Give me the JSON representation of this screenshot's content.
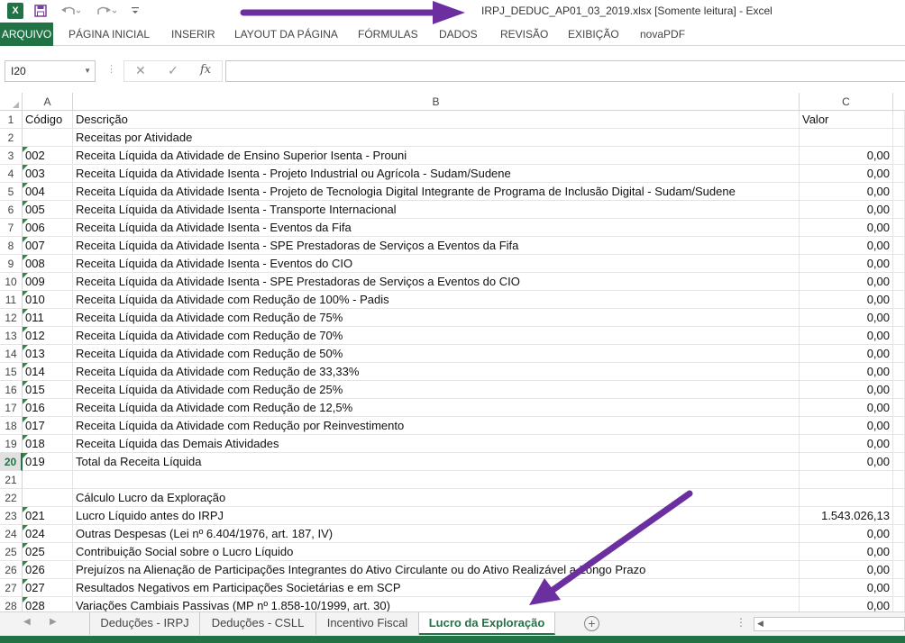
{
  "app": {
    "title": "IRPJ_DEDUC_AP01_03_2019.xlsx  [Somente leitura] - Excel",
    "logo_letter": "X",
    "icons": {
      "save": "save-icon",
      "undo": "undo-icon",
      "redo": "redo-icon",
      "customize": "customize-quick-access-icon"
    }
  },
  "ribbon": {
    "tabs": [
      {
        "label": "ARQUIVO",
        "active": true
      },
      {
        "label": "PÁGINA INICIAL"
      },
      {
        "label": "INSERIR"
      },
      {
        "label": "LAYOUT DA PÁGINA"
      },
      {
        "label": "FÓRMULAS"
      },
      {
        "label": "DADOS"
      },
      {
        "label": "REVISÃO"
      },
      {
        "label": "EXIBIÇÃO"
      },
      {
        "label": "novaPDF"
      }
    ]
  },
  "formula_bar": {
    "name_box": "I20",
    "formula": "",
    "fx_label": "fx"
  },
  "grid": {
    "columns": [
      "A",
      "B",
      "C"
    ],
    "selected_row": "20",
    "rows": [
      {
        "n": "1",
        "a": "Código",
        "b": "Descrição",
        "c": "Valor",
        "c_left": true
      },
      {
        "n": "2",
        "a": "",
        "b": "Receitas por Atividade",
        "c": ""
      },
      {
        "n": "3",
        "a": "002",
        "b": "Receita Líquida da Atividade de Ensino Superior Isenta - Prouni",
        "c": "0,00",
        "tri": true
      },
      {
        "n": "4",
        "a": "003",
        "b": "Receita Líquida da Atividade Isenta - Projeto Industrial ou Agrícola - Sudam/Sudene",
        "c": "0,00",
        "tri": true
      },
      {
        "n": "5",
        "a": "004",
        "b": "Receita Líquida da Atividade Isenta - Projeto de Tecnologia Digital Integrante de Programa de Inclusão Digital - Sudam/Sudene",
        "c": "0,00",
        "tri": true
      },
      {
        "n": "6",
        "a": "005",
        "b": "Receita Líquida da Atividade Isenta - Transporte Internacional",
        "c": "0,00",
        "tri": true
      },
      {
        "n": "7",
        "a": "006",
        "b": "Receita Líquida da Atividade Isenta - Eventos da Fifa",
        "c": "0,00",
        "tri": true
      },
      {
        "n": "8",
        "a": "007",
        "b": "Receita Líquida da Atividade Isenta - SPE Prestadoras de Serviços a Eventos da Fifa",
        "c": "0,00",
        "tri": true
      },
      {
        "n": "9",
        "a": "008",
        "b": "Receita Líquida da Atividade Isenta - Eventos do CIO",
        "c": "0,00",
        "tri": true
      },
      {
        "n": "10",
        "a": "009",
        "b": "Receita Líquida da Atividade Isenta - SPE Prestadoras de Serviços a Eventos do CIO",
        "c": "0,00",
        "tri": true
      },
      {
        "n": "11",
        "a": "010",
        "b": "Receita Líquida da Atividade com Redução de 100% - Padis",
        "c": "0,00",
        "tri": true
      },
      {
        "n": "12",
        "a": "011",
        "b": "Receita Líquida da Atividade com Redução de 75%",
        "c": "0,00",
        "tri": true
      },
      {
        "n": "13",
        "a": "012",
        "b": "Receita Líquida da Atividade com Redução de 70%",
        "c": "0,00",
        "tri": true
      },
      {
        "n": "14",
        "a": "013",
        "b": "Receita Líquida da Atividade com Redução de 50%",
        "c": "0,00",
        "tri": true
      },
      {
        "n": "15",
        "a": "014",
        "b": "Receita Líquida da Atividade com Redução de 33,33%",
        "c": "0,00",
        "tri": true
      },
      {
        "n": "16",
        "a": "015",
        "b": "Receita Líquida da Atividade com Redução de 25%",
        "c": "0,00",
        "tri": true
      },
      {
        "n": "17",
        "a": "016",
        "b": "Receita Líquida da Atividade com Redução de 12,5%",
        "c": "0,00",
        "tri": true
      },
      {
        "n": "18",
        "a": "017",
        "b": "Receita Líquida da Atividade com Redução por Reinvestimento",
        "c": "0,00",
        "tri": true
      },
      {
        "n": "19",
        "a": "018",
        "b": "Receita Líquida das Demais Atividades",
        "c": "0,00",
        "tri": true
      },
      {
        "n": "20",
        "a": "019",
        "b": "Total da Receita Líquida",
        "c": "0,00",
        "tri": true
      },
      {
        "n": "21",
        "a": "",
        "b": "",
        "c": ""
      },
      {
        "n": "22",
        "a": "",
        "b": "Cálculo Lucro da Exploração",
        "c": ""
      },
      {
        "n": "23",
        "a": "021",
        "b": "Lucro Líquido antes do IRPJ",
        "c": "1.543.026,13",
        "tri": true
      },
      {
        "n": "24",
        "a": "024",
        "b": "Outras Despesas (Lei nº 6.404/1976, art. 187, IV)",
        "c": "0,00",
        "tri": true
      },
      {
        "n": "25",
        "a": "025",
        "b": "Contribuição Social sobre o Lucro Líquido",
        "c": "0,00",
        "tri": true
      },
      {
        "n": "26",
        "a": "026",
        "b": "Prejuízos na Alienação de Participações Integrantes do Ativo Circulante ou do Ativo Realizável a Longo Prazo",
        "c": "0,00",
        "tri": true
      },
      {
        "n": "27",
        "a": "027",
        "b": "Resultados Negativos em Participações Societárias e em SCP",
        "c": "0,00",
        "tri": true
      },
      {
        "n": "28",
        "a": "028",
        "b": "Variações Cambiais Passivas (MP nº 1.858-10/1999, art. 30)",
        "c": "0,00",
        "tri": true
      }
    ]
  },
  "sheet_tabs": [
    {
      "label": "Deduções - IRPJ"
    },
    {
      "label": "Deduções - CSLL"
    },
    {
      "label": "Incentivo Fiscal"
    },
    {
      "label": "Lucro da Exploração",
      "active": true
    }
  ],
  "colors": {
    "accent": "#217346",
    "annotation_arrow": "#6b2fa0"
  }
}
